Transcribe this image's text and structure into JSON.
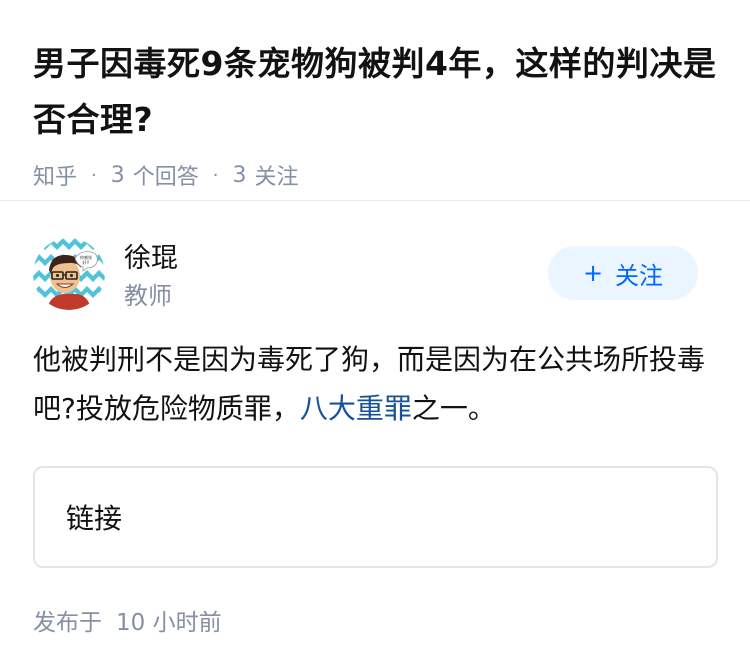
{
  "question": {
    "title": "男子因毒死9条宠物狗被判4年，这样的判决是否合理?",
    "source": "知乎",
    "answer_count": "3",
    "answer_label": "个回答",
    "follow_count": "3",
    "follow_label": "关注"
  },
  "author": {
    "name": "徐琨",
    "title": "教师",
    "avatar_icon": "cartoon-teacher-avatar-icon",
    "follow_button_plus": "+",
    "follow_button_label": "关注"
  },
  "answer": {
    "text_before_link": "他被判刑不是因为毒死了狗，而是因为在公共场所投毒吧?投放危险物质罪，",
    "link_text": "八大重罪",
    "text_after_link": "之一。",
    "link_color": "#175199"
  },
  "link_card": {
    "label": "链接"
  },
  "footer": {
    "publish_prefix": "发布于",
    "publish_time": "10 小时前"
  },
  "colors": {
    "accent": "#0066ff",
    "accent_bg": "#ebf5ff",
    "meta_gray": "#8590a6"
  }
}
